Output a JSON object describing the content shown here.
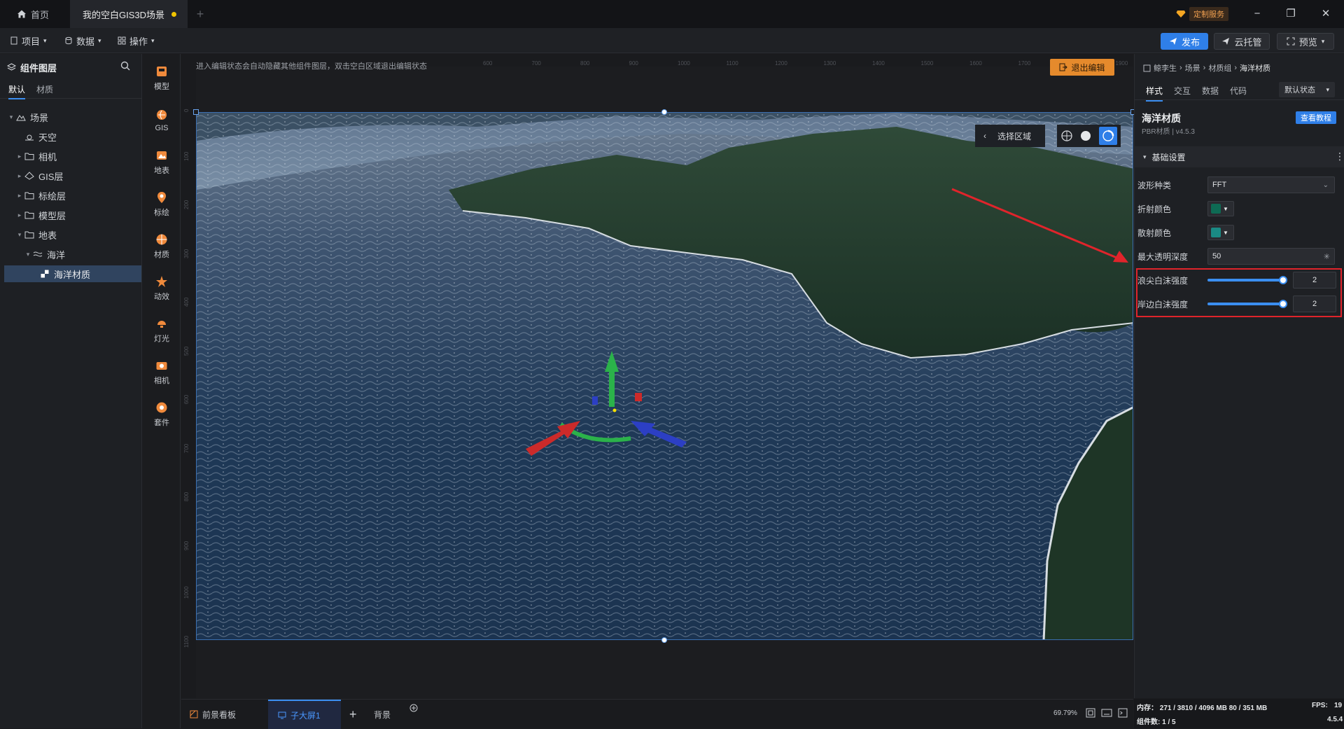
{
  "titlebar": {
    "tabs": [
      {
        "label": "首页"
      },
      {
        "label": "我的空白GIS3D场景"
      }
    ],
    "service_label": "定制服务"
  },
  "menubar": {
    "menus": [
      "项目",
      "数据",
      "操作"
    ],
    "publish_label": "发布",
    "cloud_label": "云托管",
    "preview_label": "预览"
  },
  "leftpanel": {
    "title": "组件图层",
    "tabs": [
      "默认",
      "材质"
    ],
    "tree": [
      {
        "label": "场景"
      },
      {
        "label": "天空"
      },
      {
        "label": "相机"
      },
      {
        "label": "GIS层"
      },
      {
        "label": "标绘层"
      },
      {
        "label": "模型层"
      },
      {
        "label": "地表"
      },
      {
        "label": "海洋"
      },
      {
        "label": "海洋材质"
      }
    ]
  },
  "tools": [
    "模型",
    "GIS",
    "地表",
    "标绘",
    "材质",
    "动效",
    "灯光",
    "相机",
    "套件"
  ],
  "canvas": {
    "hint": "进入编辑状态会自动隐藏其他组件图层，双击空白区域退出编辑状态",
    "exit_edit_label": "退出编辑",
    "select_area_label": "选择区域",
    "ruler_top": [
      "600",
      "700",
      "800",
      "900",
      "1000",
      "1100",
      "1200",
      "1300",
      "1400",
      "1500",
      "1600",
      "1700",
      "1800",
      "1900"
    ],
    "ruler_left": [
      "0",
      "100",
      "200",
      "300",
      "400",
      "500",
      "600",
      "700",
      "800",
      "900",
      "1000",
      "1100"
    ]
  },
  "rightpanel": {
    "breadcrumb": [
      "鲸李生",
      "场景",
      "材质组",
      "海洋材质"
    ],
    "tabs": [
      "样式",
      "交互",
      "数据",
      "代码"
    ],
    "state_select": "默认状态",
    "component_title": "海洋材质",
    "component_subtitle": "PBR材质 | v4.5.3",
    "tutorial_label": "查看教程",
    "section_title": "基础设置",
    "props": {
      "wave_type_label": "波形种类",
      "wave_type_value": "FFT",
      "refraction_label": "折射颜色",
      "refraction_color": "#0e6b54",
      "scatter_label": "散射颜色",
      "scatter_color": "#1a8a84",
      "max_depth_label": "最大透明深度",
      "max_depth_value": "50",
      "crest_foam_label": "浪尖白沫强度",
      "crest_foam_value": "2",
      "crest_foam_fraction": 1.0,
      "shore_foam_label": "岸边白沫强度",
      "shore_foam_value": "2",
      "shore_foam_fraction": 1.0
    }
  },
  "bottombar": {
    "tabs": [
      "前景看板",
      "子大屏1",
      "背景"
    ],
    "zoom": "69.79%"
  },
  "status": {
    "memory": "内存： 271 / 3810 / 4096 MB  80 / 351 MB",
    "fps_label": "FPS:",
    "fps_value": "19",
    "components": "组件数: 1 / 5",
    "version": "4.5.4"
  },
  "colors": {
    "accent": "#3b8ef0",
    "orange": "#f08a3c",
    "highlight_red": "#e0242b"
  }
}
